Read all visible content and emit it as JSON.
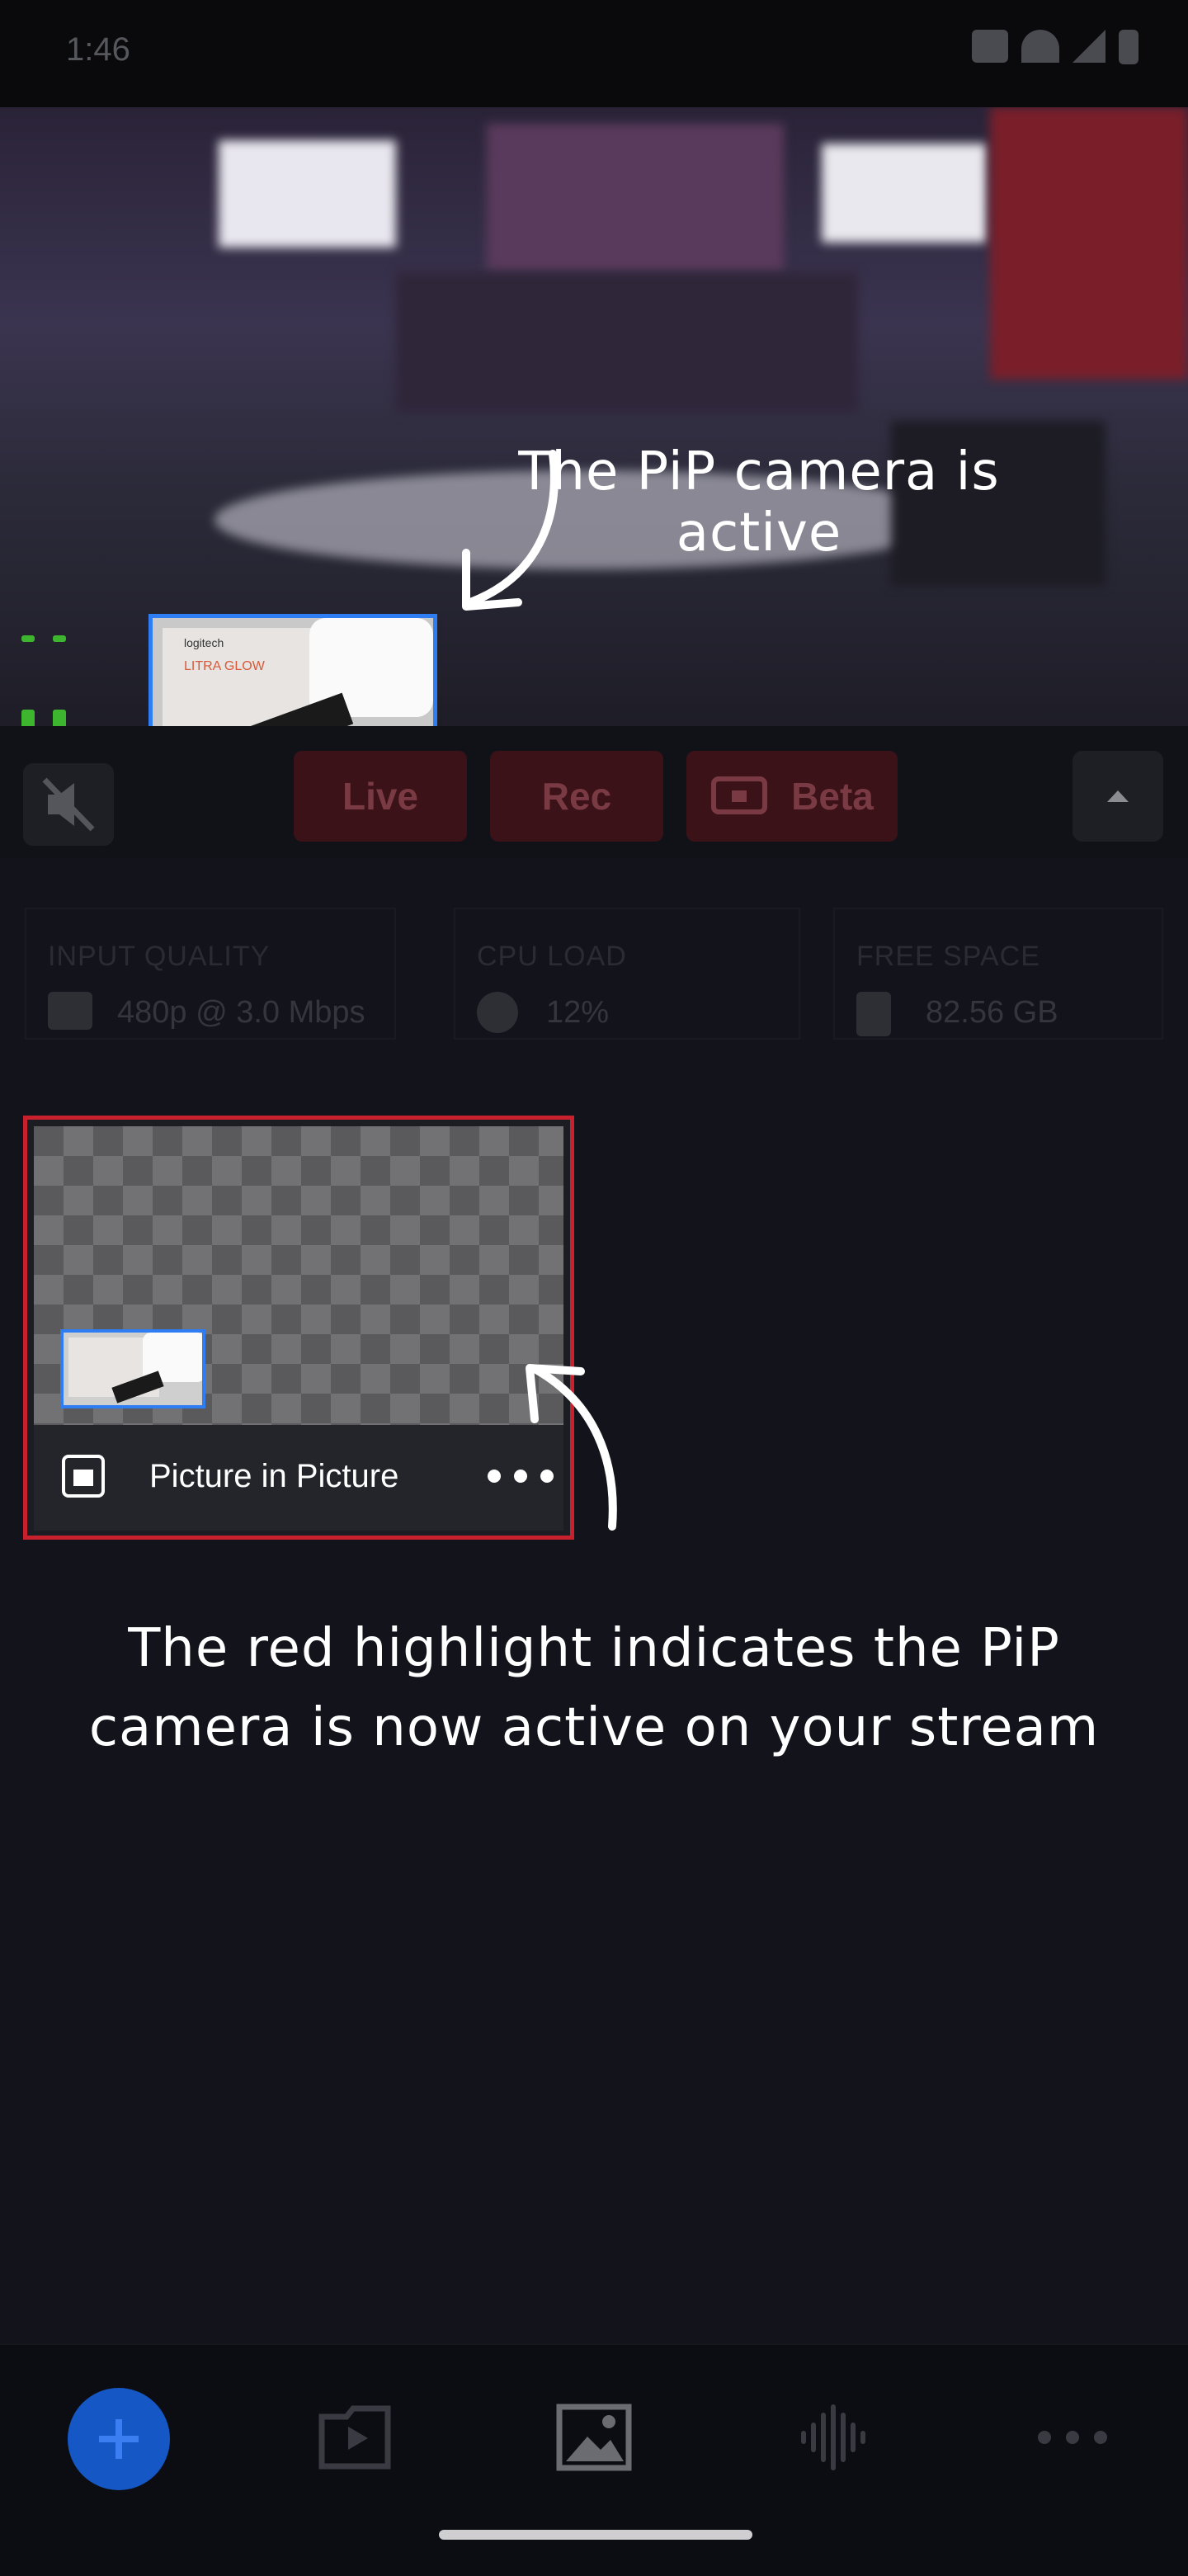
{
  "status_bar": {
    "time": "1:46",
    "icons": [
      "briefcase-icon",
      "wifi-icon",
      "signal-icon",
      "battery-icon"
    ]
  },
  "preview": {
    "callout": "The PiP camera is active",
    "pip_label_brand": "logitech",
    "pip_label_product": "LITRA GLOW"
  },
  "controls": {
    "live_label": "Live",
    "rec_label": "Rec",
    "beta_label": "Beta"
  },
  "stats": [
    {
      "title": "INPUT QUALITY",
      "value": "480p @ 3.0 Mbps",
      "icon": "camera-icon"
    },
    {
      "title": "CPU LOAD",
      "value": "12%",
      "icon": "cpu-icon"
    },
    {
      "title": "FREE SPACE",
      "value": "82.56 GB",
      "icon": "sd-card-icon"
    }
  ],
  "scene": {
    "label": "Picture in Picture",
    "callout": "The red highlight indicates the PiP camera is now active on your stream"
  },
  "bottom_nav": {
    "items": [
      "add-icon",
      "scenes-icon",
      "image-icon",
      "audio-icon",
      "more-icon"
    ]
  },
  "colors": {
    "highlight": "#c9202d",
    "pip_border": "#2f7df2",
    "accent": "#1457c5"
  }
}
